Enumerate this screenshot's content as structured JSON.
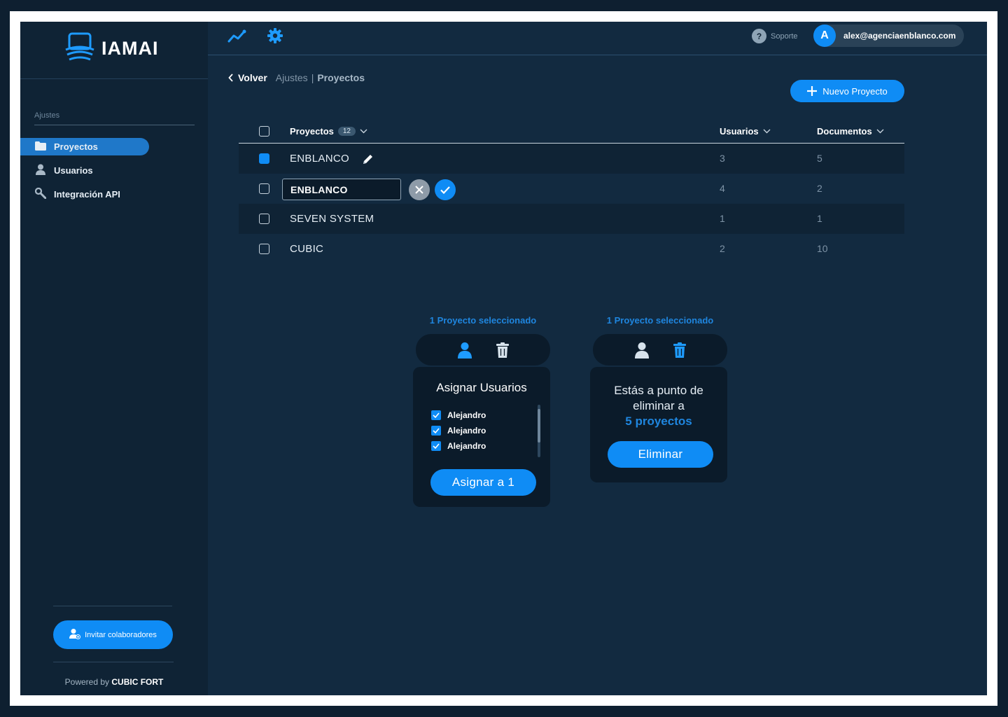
{
  "app": {
    "logo_text": "IAMAI"
  },
  "sidebar": {
    "section_label": "Ajustes",
    "items": [
      {
        "label": "Proyectos",
        "icon": "folder-icon",
        "active": true
      },
      {
        "label": "Usuarios",
        "icon": "user-icon",
        "active": false
      },
      {
        "label": "Integración API",
        "icon": "wrench-icon",
        "active": false
      }
    ],
    "invite_label": "Invitar colaboradores",
    "powered_prefix": "Powered by",
    "powered_brand": "CUBIC FORT"
  },
  "topbar": {
    "support_label": "Soporte",
    "user_initial": "A",
    "user_email": "alex@agenciaenblanco.com"
  },
  "breadcrumb": {
    "back_label": "Volver",
    "parent": "Ajustes",
    "separator": "|",
    "current": "Proyectos"
  },
  "new_project_label": "Nuevo Proyecto",
  "table": {
    "headers": {
      "name": "Proyectos",
      "count": "12",
      "users": "Usuarios",
      "documents": "Documentos"
    },
    "rows": [
      {
        "name": "ENBLANCO",
        "users": "3",
        "documents": "5",
        "checked": true,
        "editing": false
      },
      {
        "name": "ENBLANCO",
        "users": "4",
        "documents": "2",
        "checked": false,
        "editing": true
      },
      {
        "name": "SEVEN SYSTEM",
        "users": "1",
        "documents": "1",
        "checked": false,
        "editing": false
      },
      {
        "name": "CUBIC",
        "users": "2",
        "documents": "10",
        "checked": false,
        "editing": false
      }
    ]
  },
  "assign_popover": {
    "label": "1 Proyecto seleccionado",
    "title": "Asignar Usuarios",
    "users": [
      "Alejandro",
      "Alejandro",
      "Alejandro"
    ],
    "button": "Asignar a 1"
  },
  "delete_popover": {
    "label": "1 Proyecto seleccionado",
    "line1": "Estás a punto de",
    "line2": "eliminar a",
    "count_text": "5 proyectos",
    "button": "Eliminar"
  },
  "colors": {
    "accent": "#0f8cf5",
    "background": "#122a40",
    "sidebar": "#0f2335"
  }
}
